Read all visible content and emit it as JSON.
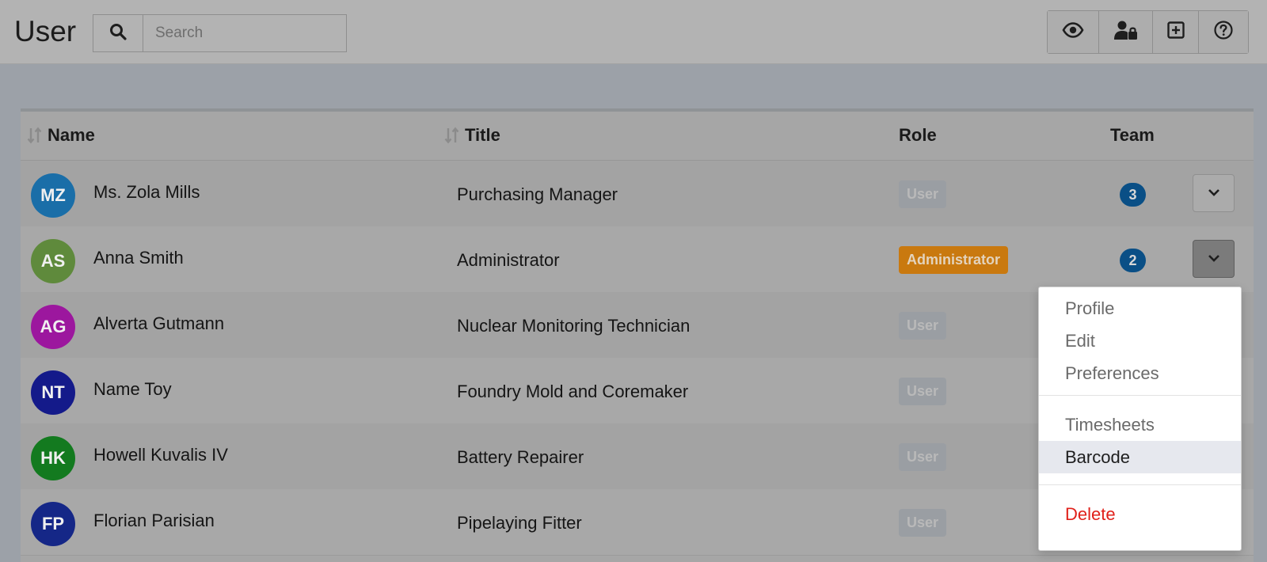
{
  "header": {
    "title": "User",
    "search_placeholder": "Search",
    "tools": [
      {
        "icon": "eye-icon"
      },
      {
        "icon": "user-lock-icon"
      },
      {
        "icon": "plus-square-icon"
      },
      {
        "icon": "help-circle-icon"
      }
    ]
  },
  "table": {
    "columns": {
      "name": "Name",
      "title": "Title",
      "role": "Role",
      "team": "Team"
    },
    "rows": [
      {
        "initials": "MZ",
        "avatar_color": "#1a6ea8",
        "name": "Ms. Zola Mills",
        "title": "Purchasing Manager",
        "role": "User",
        "team": "3"
      },
      {
        "initials": "AS",
        "avatar_color": "#5f8a3c",
        "name": "Anna Smith",
        "title": "Administrator",
        "role": "Administrator",
        "team": "2"
      },
      {
        "initials": "AG",
        "avatar_color": "#9c179e",
        "name": "Alverta Gutmann",
        "title": "Nuclear Monitoring Technician",
        "role": "User",
        "team": ""
      },
      {
        "initials": "NT",
        "avatar_color": "#141a8a",
        "name": "Name Toy",
        "title": "Foundry Mold and Coremaker",
        "role": "User",
        "team": ""
      },
      {
        "initials": "HK",
        "avatar_color": "#137a1f",
        "name": "Howell Kuvalis IV",
        "title": "Battery Repairer",
        "role": "User",
        "team": ""
      },
      {
        "initials": "FP",
        "avatar_color": "#152787",
        "name": "Florian Parisian",
        "title": "Pipelaying Fitter",
        "role": "User",
        "team": ""
      }
    ]
  },
  "dropdown": {
    "profile": "Profile",
    "edit": "Edit",
    "preferences": "Preferences",
    "timesheets": "Timesheets",
    "barcode": "Barcode",
    "delete": "Delete"
  },
  "colors": {
    "admin_badge": "#c9790f",
    "team_badge": "#0a4f86",
    "delete_text": "#e0201a"
  }
}
